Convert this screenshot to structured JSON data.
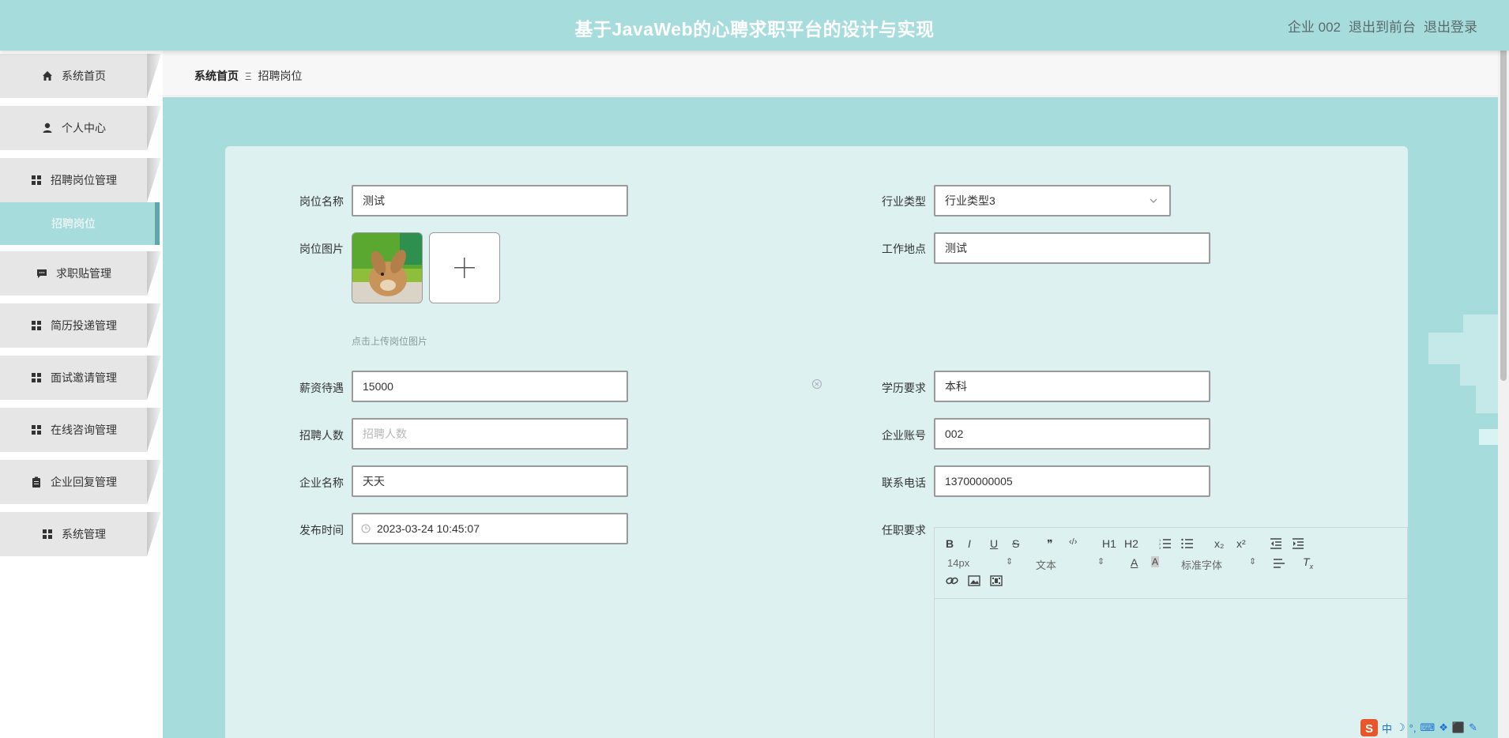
{
  "header": {
    "title": "基于JavaWeb的心聘求职平台的设计与实现",
    "user": "企业 002",
    "to_front": "退出到前台",
    "logout": "退出登录"
  },
  "sidebar": {
    "items": [
      {
        "label": "系统首页",
        "icon": "home-icon"
      },
      {
        "label": "个人中心",
        "icon": "person-icon"
      },
      {
        "label": "招聘岗位管理",
        "icon": "grid-icon"
      },
      {
        "label": "求职贴管理",
        "icon": "chat-icon"
      },
      {
        "label": "简历投递管理",
        "icon": "grid-icon"
      },
      {
        "label": "面试邀请管理",
        "icon": "grid-icon"
      },
      {
        "label": "在线咨询管理",
        "icon": "grid-icon"
      },
      {
        "label": "企业回复管理",
        "icon": "clipboard-icon"
      },
      {
        "label": "系统管理",
        "icon": "grid-icon"
      }
    ],
    "active_sub": "招聘岗位"
  },
  "breadcrumb": {
    "home": "系统首页",
    "separator": "Ξ",
    "current": "招聘岗位"
  },
  "form": {
    "job_name": {
      "label": "岗位名称",
      "value": "测试"
    },
    "industry": {
      "label": "行业类型",
      "value": "行业类型3"
    },
    "job_image": {
      "label": "岗位图片",
      "hint": "点击上传岗位图片"
    },
    "location": {
      "label": "工作地点",
      "value": "测试"
    },
    "salary": {
      "label": "薪资待遇",
      "value": "15000"
    },
    "education": {
      "label": "学历要求",
      "value": "本科"
    },
    "headcount": {
      "label": "招聘人数",
      "placeholder": "招聘人数"
    },
    "account": {
      "label": "企业账号",
      "value": "002"
    },
    "company": {
      "label": "企业名称",
      "value": "天天"
    },
    "phone": {
      "label": "联系电话",
      "value": "13700000005"
    },
    "publish_time": {
      "label": "发布时间",
      "value": "2023-03-24 10:45:07"
    },
    "requirements": {
      "label": "任职要求"
    }
  },
  "editor": {
    "font_size": "14px",
    "block": "文本",
    "font_family": "标准字体",
    "buttons": [
      "B",
      "I",
      "U",
      "S",
      "❞",
      "‹/›",
      "H1",
      "H2",
      "ol",
      "ul",
      "x₂",
      "x²",
      "outdent",
      "indent"
    ]
  },
  "ime": {
    "lang": "中"
  },
  "colors": {
    "header": "#a7dcdc",
    "main": "#a7dcdc",
    "card": "#ddf1f1",
    "sidebar_item": "#e6e6e6",
    "active_border": "#5fa8a8"
  }
}
